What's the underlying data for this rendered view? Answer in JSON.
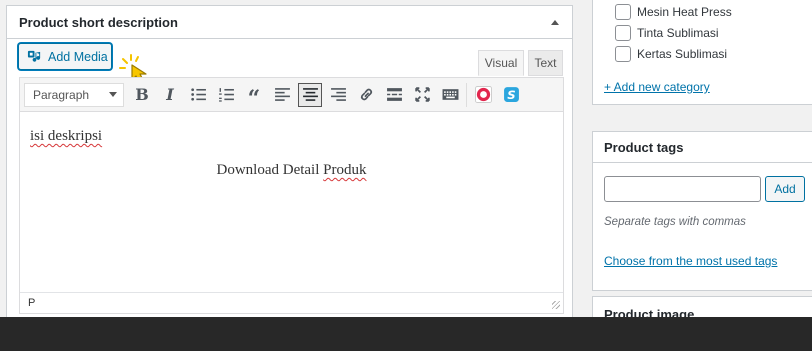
{
  "short_description": {
    "title": "Product short description",
    "add_media_label": "Add Media",
    "tabs": {
      "visual": "Visual",
      "text": "Text"
    },
    "format_select": "Paragraph",
    "toolbar_icons": [
      "bold-icon",
      "italic-icon",
      "bulleted-list-icon",
      "numbered-list-icon",
      "blockquote-icon",
      "align-left-icon",
      "align-center-icon",
      "align-right-icon",
      "insert-link-icon",
      "read-more-icon",
      "fullscreen-icon",
      "keyboard-toolbar-icon",
      "plugin-red-icon",
      "plugin-blue-icon"
    ],
    "content_line1": "isi deskripsi",
    "content_line2_prefix": "Download Detail ",
    "content_line2_word": "Produk",
    "status_path": "P"
  },
  "categories": {
    "items": [
      "Mesin Heat Press",
      "Tinta Sublimasi",
      "Kertas Sublimasi"
    ],
    "add_new": "+ Add new category"
  },
  "product_tags": {
    "title": "Product tags",
    "input_value": "",
    "add_label": "Add",
    "hint": "Separate tags with commas",
    "choose_link": "Choose from the most used tags"
  },
  "product_image": {
    "title": "Product image"
  },
  "colors": {
    "link": "#0073aa",
    "button_blue": "#0071a1",
    "bottom_bar": "#282828"
  }
}
